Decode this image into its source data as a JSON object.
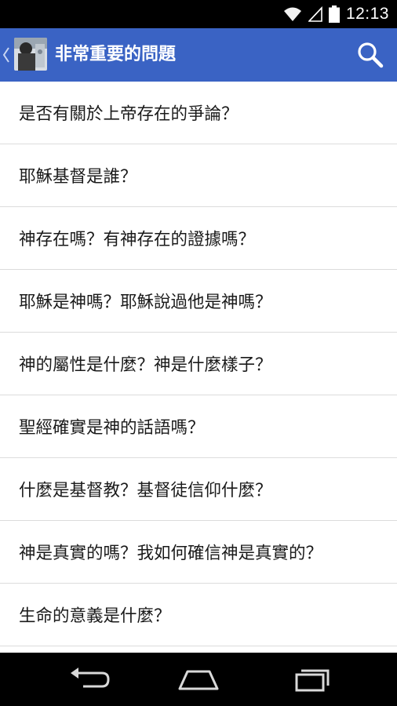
{
  "status_bar": {
    "time": "12:13",
    "icons": [
      "wifi-icon",
      "signal-icon",
      "battery-icon"
    ]
  },
  "app_bar": {
    "title": "非常重要的問題",
    "icons": [
      "back-icon",
      "avatar",
      "search-icon"
    ],
    "color": "#3a63c4"
  },
  "list": {
    "items": [
      {
        "label": "是否有關於上帝存在的爭論？"
      },
      {
        "label": "耶穌基督是誰？"
      },
      {
        "label": "神存在嗎？有神存在的證據嗎？"
      },
      {
        "label": "耶穌是神嗎？耶穌說過他是神嗎？"
      },
      {
        "label": "神的屬性是什麼？神是什麼樣子？"
      },
      {
        "label": "聖經確實是神的話語嗎？"
      },
      {
        "label": "什麼是基督教？基督徒信仰什麼？"
      },
      {
        "label": "神是真實的嗎？我如何確信神是真實的？"
      },
      {
        "label": "生命的意義是什麼？"
      }
    ]
  },
  "nav_bar": {
    "icons": [
      "back-nav-icon",
      "home-nav-icon",
      "recent-apps-icon"
    ]
  }
}
